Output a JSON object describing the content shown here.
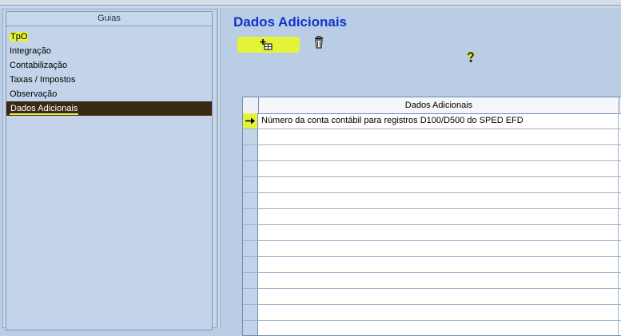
{
  "sidebar": {
    "header": "Guias",
    "items": [
      {
        "label": "TpO",
        "selected": false,
        "highlighted": true
      },
      {
        "label": "Integração",
        "selected": false,
        "highlighted": false
      },
      {
        "label": "Contabilização",
        "selected": false,
        "highlighted": false
      },
      {
        "label": "Taxas / Impostos",
        "selected": false,
        "highlighted": false
      },
      {
        "label": "Observação",
        "selected": false,
        "highlighted": false
      },
      {
        "label": "Dados Adicionais",
        "selected": true,
        "highlighted": true
      }
    ]
  },
  "main": {
    "title": "Dados Adicionais",
    "toolbar": {
      "add_icon": "add-row-icon",
      "delete_icon": "trash-icon",
      "help_icon": "help-question-icon"
    },
    "grid": {
      "column_header": "Dados Adicionais",
      "rows": [
        "Número da conta contábil para registros D100/D500 do SPED EFD",
        "",
        "",
        "",
        "",
        "",
        "",
        "",
        "",
        "",
        "",
        "",
        "",
        ""
      ],
      "current_row_indicator": "→"
    }
  },
  "colors": {
    "background": "#b9cde5",
    "title": "#1133cc",
    "selected_row": "#3a2a14",
    "highlight": "#e6f23a"
  }
}
